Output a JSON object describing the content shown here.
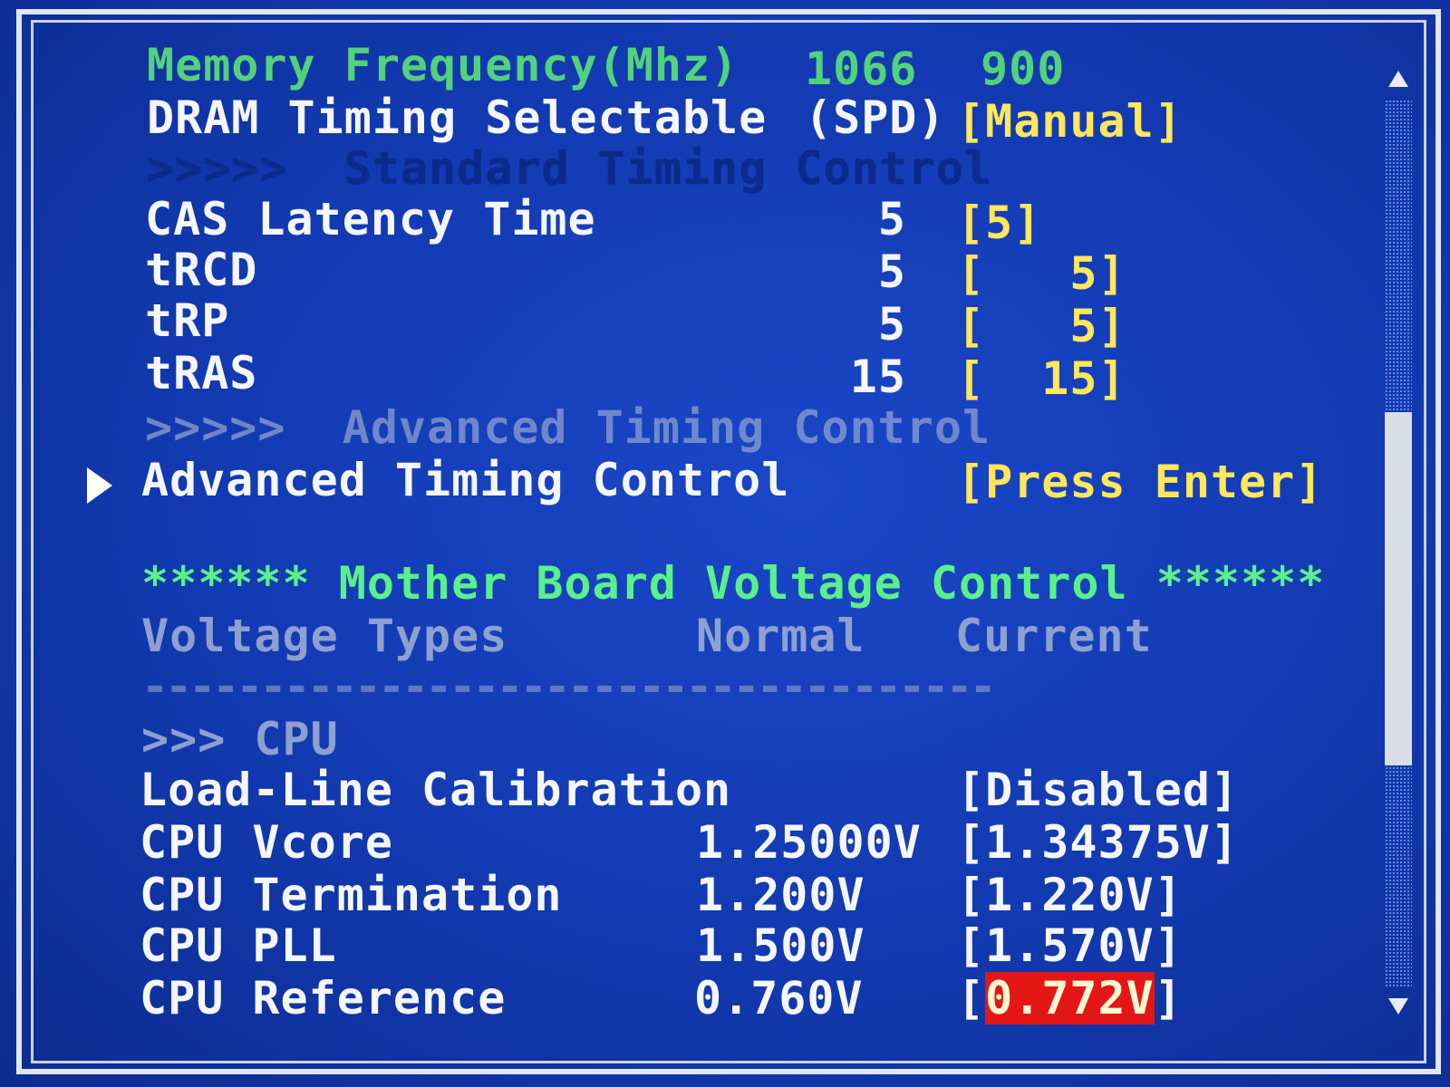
{
  "memory": {
    "frequency_label": "Memory Frequency(Mhz)",
    "frequency_spd": "1066",
    "frequency_current": "900",
    "dram_timing_label": "DRAM Timing Selectable",
    "dram_timing_spd": "(SPD)",
    "dram_timing_value": "[Manual]",
    "standard_header": ">>>>>  Standard Timing Control",
    "timings": [
      {
        "label": "CAS Latency Time",
        "spd": "5",
        "value": "[5]"
      },
      {
        "label": "tRCD",
        "spd": "5",
        "value": "[   5]"
      },
      {
        "label": "tRP",
        "spd": "5",
        "value": "[   5]"
      },
      {
        "label": "tRAS",
        "spd": "15",
        "value": "[  15]"
      }
    ],
    "advanced_header": ">>>>>  Advanced Timing Control",
    "advanced_item_label": "Advanced Timing Control",
    "advanced_item_value": "[Press Enter]"
  },
  "voltage": {
    "section_title": "****** Mother Board Voltage Control ******",
    "col_types": "Voltage Types",
    "col_normal": "Normal",
    "col_current": "Current",
    "divider": "------------------------------------",
    "cpu_header": ">>> CPU",
    "llc_label": "Load-Line Calibration",
    "llc_value": "[Disabled]",
    "items": [
      {
        "label": "CPU Vcore",
        "normal": "1.25000V",
        "value": "[1.34375V]"
      },
      {
        "label": "CPU Termination",
        "normal": "1.200V",
        "value": "[1.220V]"
      },
      {
        "label": "CPU PLL",
        "normal": "1.500V",
        "value": "[1.570V]"
      }
    ],
    "reference": {
      "label": "CPU Reference",
      "normal": "0.760V",
      "bracket_open": "[",
      "value": "0.772V",
      "bracket_close": "]"
    }
  },
  "colors": {
    "background": "#1239b0",
    "label": "#f4f6fb",
    "value": "#ffe65a",
    "heading": "#5af08a",
    "disabled": "#8ea0cf",
    "highlight": "#e51616"
  },
  "icons": {
    "selection_pointer": "right-triangle",
    "scroll_up": "up-triangle",
    "scroll_down": "down-triangle"
  }
}
